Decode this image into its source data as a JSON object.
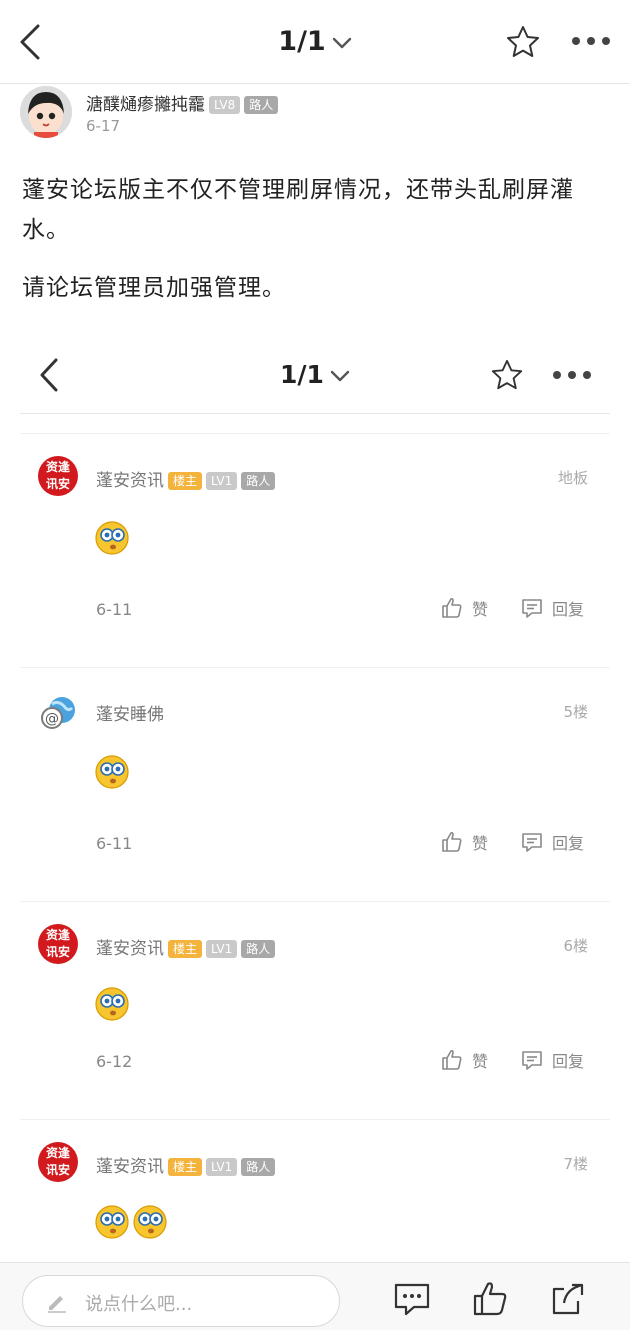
{
  "nav": {
    "page_indicator": "1/1"
  },
  "author": {
    "name": "溏醭熥瘆攡扽靇",
    "level": "LV8",
    "role": "路人",
    "date": "6-17"
  },
  "post": {
    "paragraphs": [
      "蓬安论坛版主不仅不管理刷屏情况，还带头乱刷屏灌水。",
      "请论坛管理员加强管理。"
    ]
  },
  "embedded": {
    "page_indicator": "1/1",
    "floors": [
      {
        "user": "蓬安资讯",
        "owner_tag": "楼主",
        "level": "LV1",
        "role": "路人",
        "label": "地板",
        "date": "6-11",
        "like_label": "赞",
        "reply_label": "回复",
        "avatar": "news-logo",
        "emoji_count": 1
      },
      {
        "user": "蓬安睡佛",
        "label": "5楼",
        "date": "6-11",
        "like_label": "赞",
        "reply_label": "回复",
        "avatar": "globe-at-icon",
        "emoji_count": 1
      },
      {
        "user": "蓬安资讯",
        "owner_tag": "楼主",
        "level": "LV1",
        "role": "路人",
        "label": "6楼",
        "date": "6-12",
        "like_label": "赞",
        "reply_label": "回复",
        "avatar": "news-logo",
        "emoji_count": 1
      },
      {
        "user": "蓬安资讯",
        "owner_tag": "楼主",
        "level": "LV1",
        "role": "路人",
        "label": "7楼",
        "avatar": "news-logo",
        "emoji_count": 2
      }
    ],
    "logo_text": [
      "资逢",
      "讯安"
    ]
  },
  "bottom": {
    "input_placeholder": "说点什么吧..."
  },
  "colors": {
    "owner_tag": "#f3b33d",
    "level_tag": "#c9c9c9",
    "role_tag": "#a8a8a8",
    "logo_red": "#d21a1e"
  }
}
